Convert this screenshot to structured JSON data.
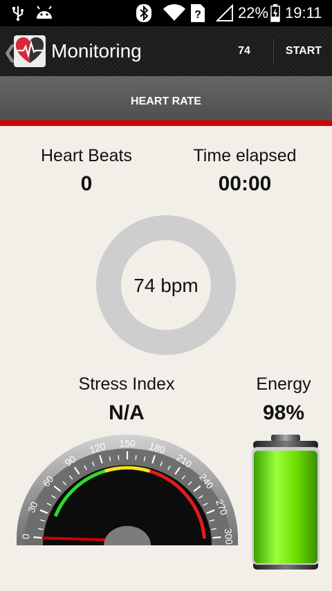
{
  "status_bar": {
    "battery_percent": "22%",
    "time": "19:11",
    "icons": [
      "usb-icon",
      "android-icon",
      "bluetooth-icon",
      "wifi-icon",
      "sim-unknown-icon",
      "signal-icon",
      "battery-charging-icon"
    ]
  },
  "action_bar": {
    "title": "Monitoring",
    "bpm_value": "74",
    "start_label": "START",
    "back_icon": "chevron-left-icon",
    "logo_icon": "heart-pulse-logo-icon"
  },
  "tabs": {
    "active_label": "HEART RATE",
    "indicator_color": "#d40000"
  },
  "metrics": {
    "heart_beats": {
      "label": "Heart Beats",
      "value": "0"
    },
    "time_elapsed": {
      "label": "Time elapsed",
      "value": "00:00"
    },
    "bpm_display": "74 bpm",
    "stress_index": {
      "label": "Stress Index",
      "value": "N/A"
    },
    "energy": {
      "label": "Energy",
      "value": "98%",
      "level": 0.98
    }
  },
  "gauge": {
    "ticks": [
      "0",
      "30",
      "60",
      "90",
      "120",
      "150",
      "180",
      "210",
      "240",
      "270",
      "300"
    ],
    "needle_value": 0,
    "zones": [
      {
        "from": 30,
        "to": 120,
        "color": "#2ed82e"
      },
      {
        "from": 120,
        "to": 180,
        "color": "#f0e21c"
      },
      {
        "from": 180,
        "to": 300,
        "color": "#e01b1b"
      }
    ]
  }
}
